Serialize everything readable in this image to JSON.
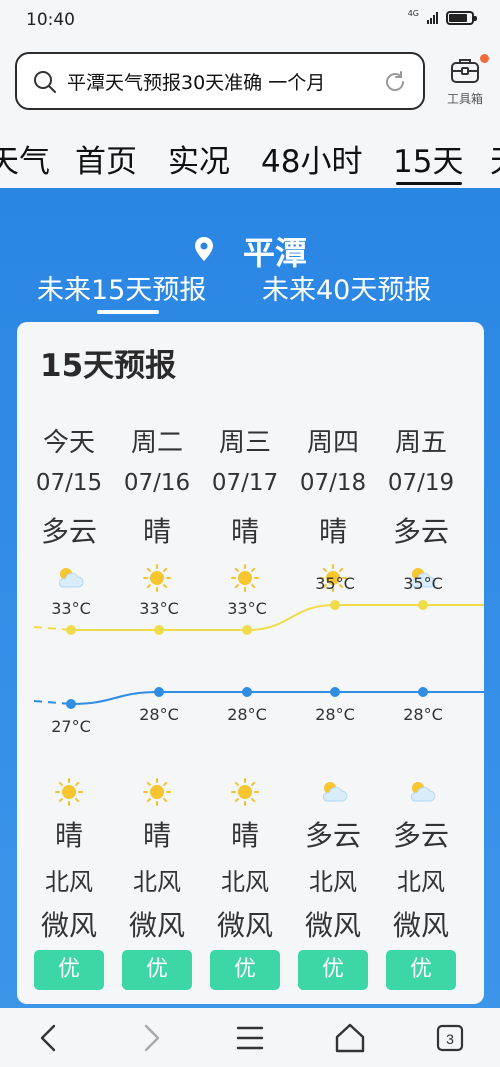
{
  "status": {
    "time": "10:40",
    "network": "4G"
  },
  "search": {
    "query": "平潭天气预报30天准确 一个月"
  },
  "toolbox": {
    "label": "工具箱"
  },
  "tabs": [
    "天气",
    "首页",
    "实况",
    "48小时",
    "15天",
    "天"
  ],
  "active_tab": "15天",
  "city": "平潭",
  "sub_tabs": [
    "未来15天预报",
    "未来40天预报"
  ],
  "card_title": "15天预报",
  "days": [
    {
      "name": "今天",
      "date": "07/15",
      "day_weather": "多云",
      "day_icon": "cloud-sun-icon",
      "high": "33°C",
      "low": "27°C",
      "night_icon": "sun-icon",
      "night_weather": "晴",
      "wind_dir": "北风",
      "wind_level": "微风",
      "aqi": "优"
    },
    {
      "name": "周二",
      "date": "07/16",
      "day_weather": "晴",
      "day_icon": "sun-icon",
      "high": "33°C",
      "low": "28°C",
      "night_icon": "sun-icon",
      "night_weather": "晴",
      "wind_dir": "北风",
      "wind_level": "微风",
      "aqi": "优"
    },
    {
      "name": "周三",
      "date": "07/17",
      "day_weather": "晴",
      "day_icon": "sun-icon",
      "high": "33°C",
      "low": "28°C",
      "night_icon": "sun-icon",
      "night_weather": "晴",
      "wind_dir": "北风",
      "wind_level": "微风",
      "aqi": "优"
    },
    {
      "name": "周四",
      "date": "07/18",
      "day_weather": "晴",
      "day_icon": "sun-icon",
      "high": "35°C",
      "low": "28°C",
      "night_icon": "cloud-sun-icon",
      "night_weather": "多云",
      "wind_dir": "北风",
      "wind_level": "微风",
      "aqi": "优"
    },
    {
      "name": "周五",
      "date": "07/19",
      "day_weather": "多云",
      "day_icon": "cloud-sun-icon",
      "high": "35°C",
      "low": "28°C",
      "night_icon": "cloud-sun-icon",
      "night_weather": "多云",
      "wind_dir": "北风",
      "wind_level": "微风",
      "aqi": "优"
    }
  ],
  "chart_data": {
    "type": "line",
    "categories": [
      "07/15",
      "07/16",
      "07/17",
      "07/18",
      "07/19"
    ],
    "series": [
      {
        "values": [
          33,
          33,
          33,
          35,
          35
        ],
        "color": "#f0dc4a"
      },
      {
        "values": [
          27,
          28,
          28,
          28,
          28
        ],
        "color": "#2f8de4"
      }
    ]
  },
  "nav": {
    "tab_count": "3"
  },
  "colors": {
    "accent_blue": "#2a86e3",
    "aqi_green": "#3dd6a6",
    "high_line": "#f0dc4a",
    "low_line": "#2f8de4"
  }
}
